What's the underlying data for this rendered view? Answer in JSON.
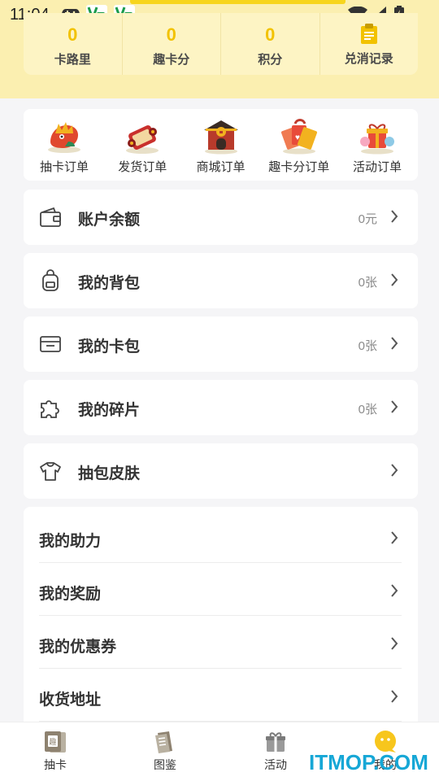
{
  "status_bar": {
    "time": "11:04"
  },
  "stats": [
    {
      "value": "0",
      "label": "卡路里"
    },
    {
      "value": "0",
      "label": "趣卡分"
    },
    {
      "value": "0",
      "label": "积分"
    },
    {
      "label": "兑消记录",
      "icon": "clipboard-icon"
    }
  ],
  "orders": [
    {
      "label": "抽卡订单",
      "icon": "dragon-orders-icon"
    },
    {
      "label": "发货订单",
      "icon": "scroll-orders-icon"
    },
    {
      "label": "商城订单",
      "icon": "temple-orders-icon"
    },
    {
      "label": "趣卡分订单",
      "icon": "card-fan-orders-icon"
    },
    {
      "label": "活动订单",
      "icon": "gift-orders-icon"
    }
  ],
  "menu": [
    {
      "label": "账户余额",
      "value": "0元",
      "icon": "wallet-icon"
    },
    {
      "label": "我的背包",
      "value": "0张",
      "icon": "backpack-icon"
    },
    {
      "label": "我的卡包",
      "value": "0张",
      "icon": "card-holder-icon"
    },
    {
      "label": "我的碎片",
      "value": "0张",
      "icon": "puzzle-icon"
    },
    {
      "label": "抽包皮肤",
      "value": "",
      "icon": "tshirt-icon"
    }
  ],
  "group_menu": [
    {
      "label": "我的助力"
    },
    {
      "label": "我的奖励"
    },
    {
      "label": "我的优惠券"
    },
    {
      "label": "收货地址"
    }
  ],
  "tabbar": [
    {
      "label": "抽卡",
      "icon": "card-draw-icon"
    },
    {
      "label": "图鉴",
      "icon": "catalog-icon"
    },
    {
      "label": "活动",
      "icon": "gift-box-icon"
    },
    {
      "label": "我的",
      "icon": "smiley-chat-icon"
    }
  ],
  "watermark": "ITMOP.COM",
  "colors": {
    "accent": "#f2c200",
    "header_bg": "#fbefb0",
    "watermark": "#16a7d6"
  }
}
